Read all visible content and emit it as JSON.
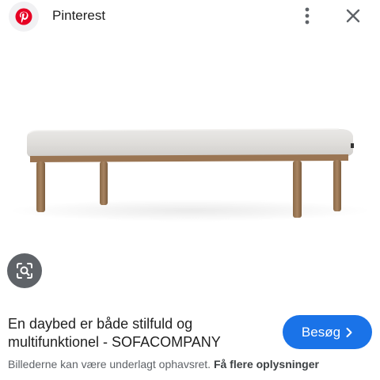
{
  "header": {
    "app_title": "Pinterest",
    "logo_icon": "pinterest-logo-icon",
    "more_icon": "more-vertical-icon",
    "close_icon": "close-icon"
  },
  "image": {
    "subject": "daybed"
  },
  "lens": {
    "icon": "lens-search-icon"
  },
  "caption": {
    "text": "En daybed er både stilfuld og multifunktionel - SOFACOMPANY"
  },
  "visit_button": {
    "label": "Besøg",
    "icon": "chevron-right-icon",
    "color": "#1a73e8"
  },
  "footer": {
    "notice": "Billederne kan være underlagt ophavsret.",
    "link_label": "Få flere oplysninger"
  },
  "colors": {
    "brand_red": "#e60023",
    "text_primary": "#1f1f1f",
    "text_secondary": "#5f6368"
  }
}
